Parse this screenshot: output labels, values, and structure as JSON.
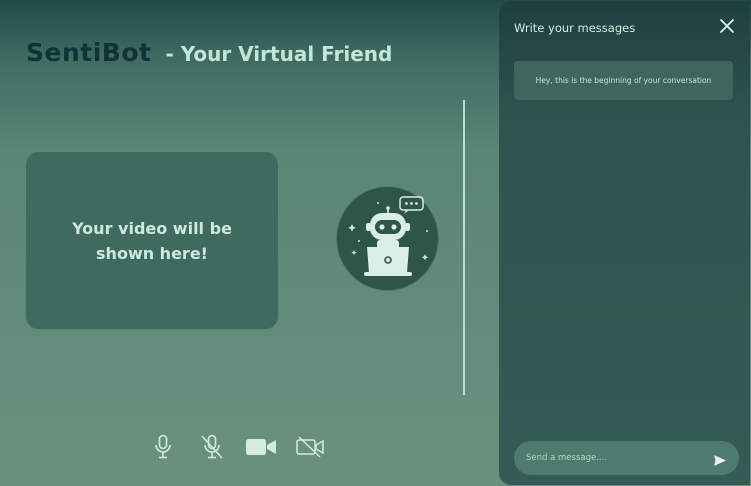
{
  "header": {
    "brand": "SentiBot",
    "tagline": "- Your Virtual Friend"
  },
  "video": {
    "placeholder_text": "Your video will be shown here!"
  },
  "bot": {
    "avatar_icon": "robot-laptop-icon"
  },
  "controls": [
    {
      "name": "microphone-on",
      "icon": "microphone-icon"
    },
    {
      "name": "microphone-off",
      "icon": "microphone-off-icon"
    },
    {
      "name": "camera-on",
      "icon": "video-camera-icon"
    },
    {
      "name": "camera-off",
      "icon": "video-camera-off-icon"
    }
  ],
  "chat": {
    "title": "Write your messages",
    "intro": "Hey, this is the beginning of your conversation",
    "input_placeholder": "Send a message....",
    "input_value": "",
    "close_icon": "close-icon",
    "send_icon": "send-icon"
  },
  "colors": {
    "brand": "#0e3338",
    "tagline": "#c3e6d6",
    "panel_bg": "#2f5450",
    "video_box": "#3f6a60",
    "icon": "#d5ebe0"
  }
}
